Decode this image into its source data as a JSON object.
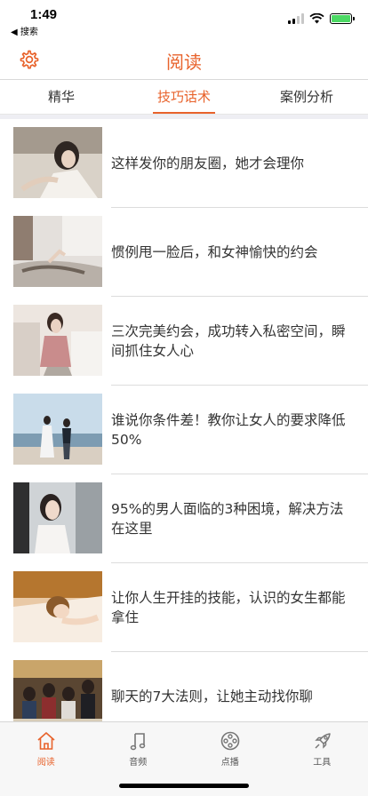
{
  "status_bar": {
    "time": "1:49",
    "back_label": "◀ 搜索"
  },
  "header": {
    "title": "阅读",
    "settings_icon": "gear-icon"
  },
  "accent_color": "#e8632c",
  "tabs": [
    {
      "label": "精华",
      "active": false
    },
    {
      "label": "技巧话术",
      "active": true
    },
    {
      "label": "案例分析",
      "active": false
    }
  ],
  "articles": [
    {
      "title": "这样发你的朋友圈，她才会理你"
    },
    {
      "title": "惯例甩一脸后，和女神愉快的约会"
    },
    {
      "title": "三次完美约会，成功转入私密空间，瞬间抓住女人心"
    },
    {
      "title": "谁说你条件差！教你让女人的要求降低50%"
    },
    {
      "title": "95%的男人面临的3种困境，解决方法在这里"
    },
    {
      "title": "让你人生开挂的技能，认识的女生都能拿住"
    },
    {
      "title": "聊天的7大法则，让她主动找你聊"
    }
  ],
  "bottom_nav": [
    {
      "label": "阅读",
      "icon": "home-icon",
      "active": true
    },
    {
      "label": "音频",
      "icon": "music-note-icon",
      "active": false
    },
    {
      "label": "点播",
      "icon": "film-reel-icon",
      "active": false
    },
    {
      "label": "工具",
      "icon": "rocket-icon",
      "active": false
    }
  ]
}
